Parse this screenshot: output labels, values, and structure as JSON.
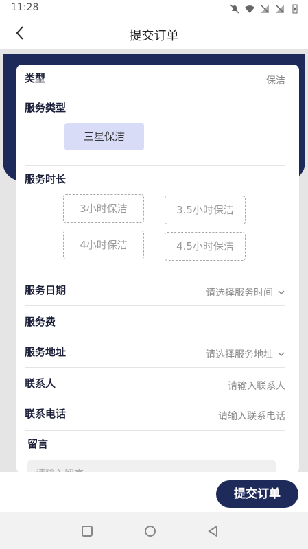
{
  "status": {
    "time": "11:28"
  },
  "header": {
    "title": "提交订单"
  },
  "form": {
    "type_label": "类型",
    "type_value": "保洁",
    "service_type_label": "服务类型",
    "service_type_option": "三星保洁",
    "duration_label": "服务时长",
    "durations": [
      "3小时保洁",
      "3.5小时保洁",
      "4小时保洁",
      "4.5小时保洁"
    ],
    "date_label": "服务日期",
    "date_placeholder": "请选择服务时间",
    "fee_label": "服务费",
    "address_label": "服务地址",
    "address_placeholder": "请选择服务地址",
    "contact_label": "联系人",
    "contact_placeholder": "请输入联系人",
    "phone_label": "联系电话",
    "phone_placeholder": "请输入联系电话",
    "message_label": "留言",
    "message_placeholder": "请输入留言"
  },
  "footer": {
    "submit_label": "提交订单"
  },
  "colors": {
    "primary": "#1e2a5a",
    "chip_selected": "#d9dcf7"
  }
}
